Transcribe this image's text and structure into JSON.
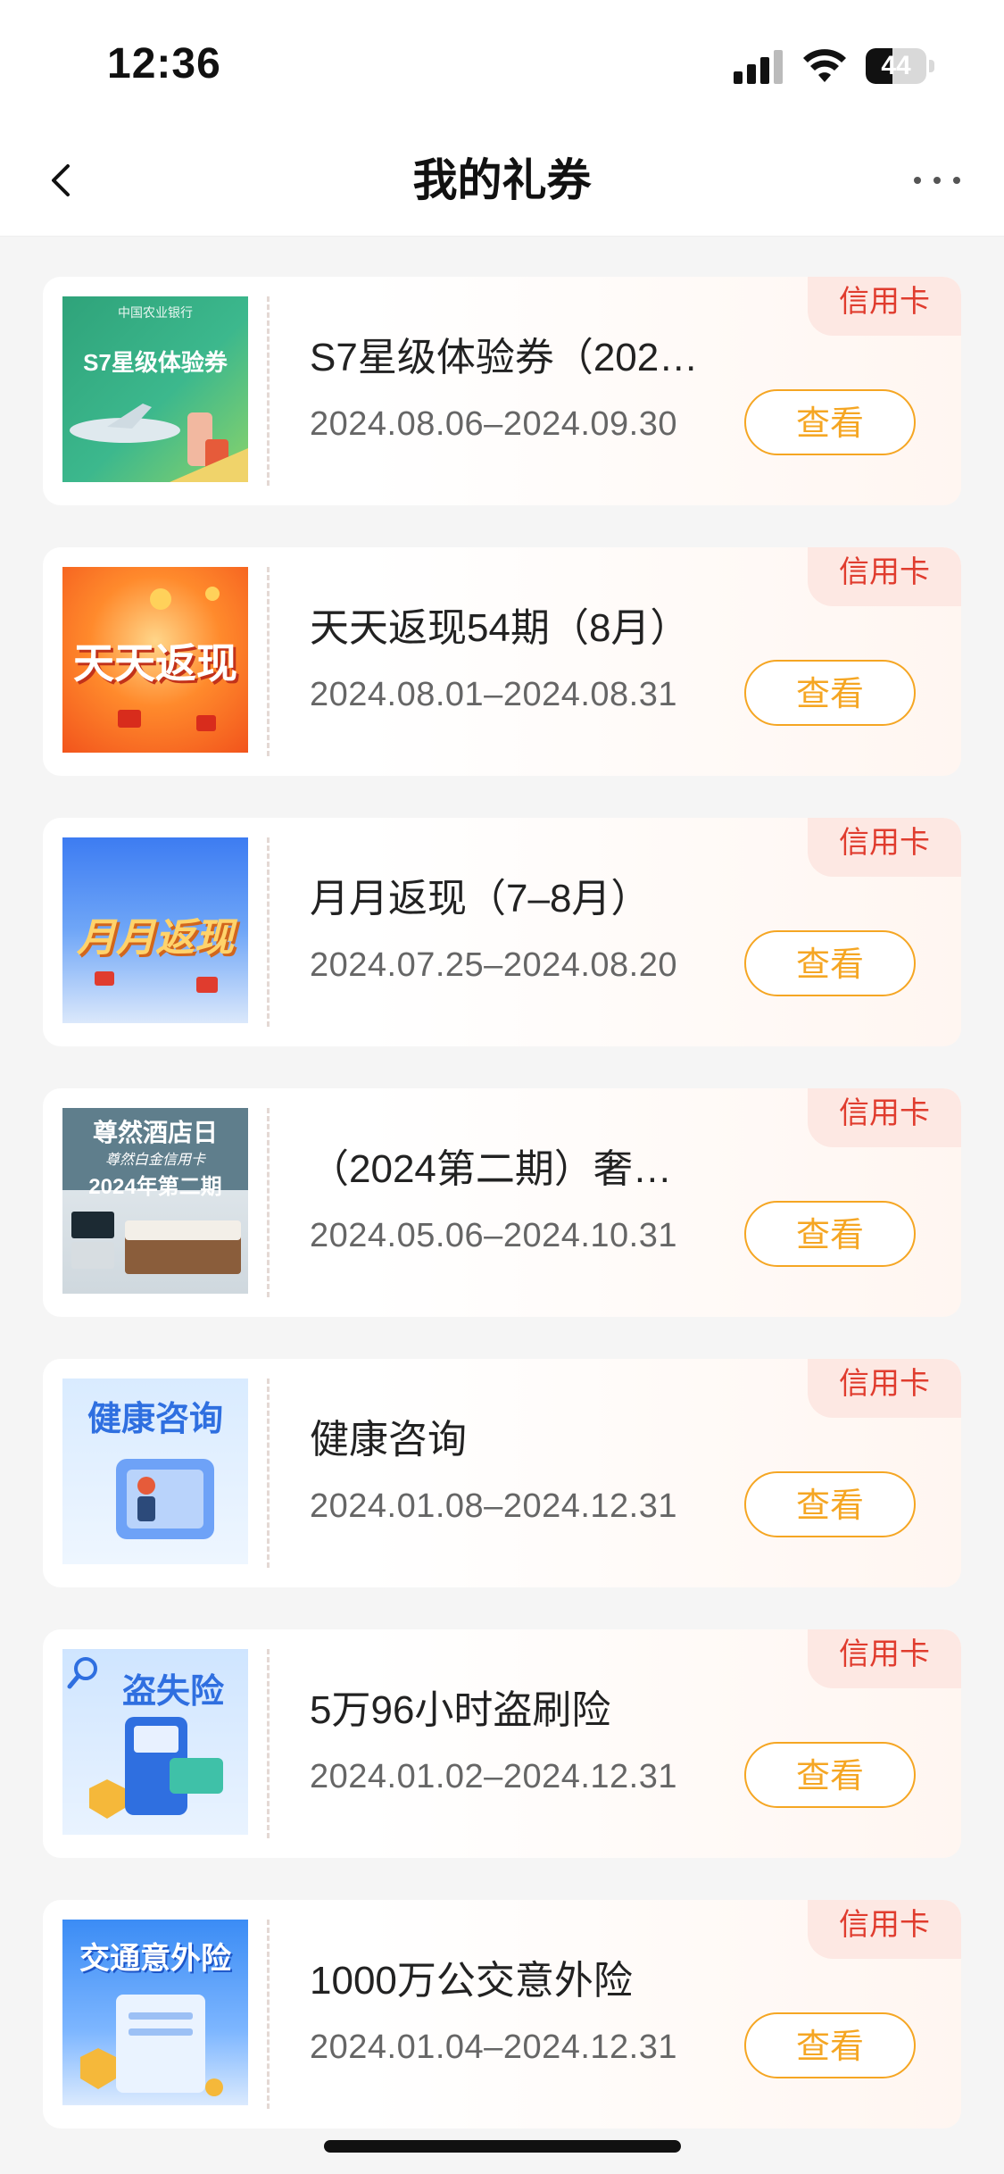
{
  "status_bar": {
    "time": "12:36",
    "battery_level": "44",
    "battery_fraction": 0.44,
    "icons": [
      "signal-icon",
      "wifi-icon",
      "battery-icon"
    ]
  },
  "nav": {
    "title": "我的礼券",
    "back_icon": "chevron-left-icon",
    "more_icon": "more-dots-icon"
  },
  "colors": {
    "accent": "#f5a623",
    "tag_text": "#e03c2e",
    "tag_bg": "#fde8e3",
    "page_bg": "#f5f5f5"
  },
  "coupons": [
    {
      "name": "S7星级体验券（202…",
      "date": "2024.08.06–2024.09.30",
      "tag": "信用卡",
      "button": "查看",
      "thumb_text": "S7星级体验券",
      "thumb_sub": "中国农业银行"
    },
    {
      "name": "天天返现54期（8月）",
      "date": "2024.08.01–2024.08.31",
      "tag": "信用卡",
      "button": "查看",
      "thumb_text": "天天返现"
    },
    {
      "name": "月月返现（7–8月）",
      "date": "2024.07.25–2024.08.20",
      "tag": "信用卡",
      "button": "查看",
      "thumb_text": "月月返现"
    },
    {
      "name": "（2024第二期）奢…",
      "date": "2024.05.06–2024.10.31",
      "tag": "信用卡",
      "button": "查看",
      "thumb_text": "尊然酒店日",
      "thumb_sub": "尊然白金信用卡",
      "thumb_text2": "2024年第二期"
    },
    {
      "name": "健康咨询",
      "date": "2024.01.08–2024.12.31",
      "tag": "信用卡",
      "button": "查看",
      "thumb_text": "健康咨询"
    },
    {
      "name": "5万96小时盗刷险",
      "date": "2024.01.02–2024.12.31",
      "tag": "信用卡",
      "button": "查看",
      "thumb_text": "盗失险"
    },
    {
      "name": "1000万公交意外险",
      "date": "2024.01.04–2024.12.31",
      "tag": "信用卡",
      "button": "查看",
      "thumb_text": "交通意外险"
    }
  ]
}
